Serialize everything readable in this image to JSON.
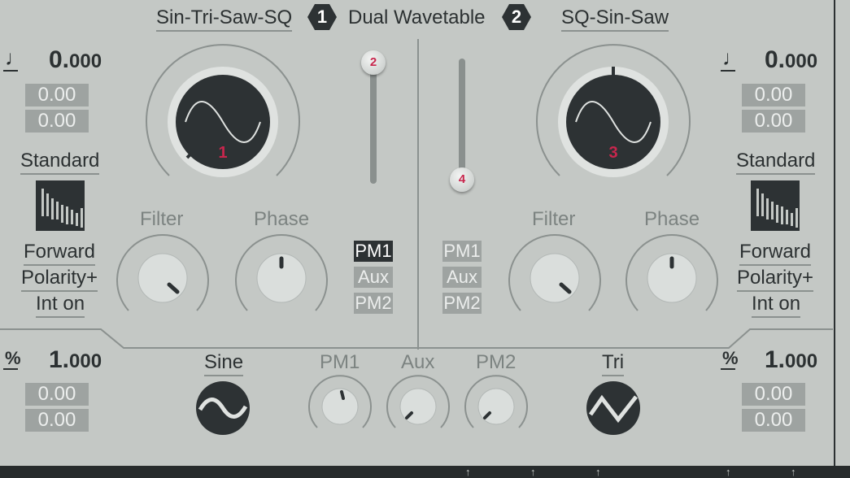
{
  "header": {
    "osc1_wavetable": "Sin-Tri-Saw-SQ",
    "osc1_badge": "1",
    "title": "Dual Wavetable",
    "osc2_badge": "2",
    "osc2_wavetable": "SQ-Sin-Saw"
  },
  "osc1": {
    "note_icon": "note-icon",
    "pitch_int": "0.",
    "pitch_frac": "000",
    "pitch_val1": "0.00",
    "pitch_val2": "0.00",
    "mode": "Standard",
    "direction": "Forward",
    "polarity": "Polarity+",
    "interp": "Int on",
    "main_knob_marker": "1",
    "filter_label": "Filter",
    "phase_label": "Phase",
    "percent_icon": "percent-icon",
    "amount_int": "1.",
    "amount_frac": "000",
    "amount_val1": "0.00",
    "amount_val2": "0.00"
  },
  "osc2": {
    "note_icon": "note-icon",
    "pitch_int": "0.",
    "pitch_frac": "000",
    "pitch_val1": "0.00",
    "pitch_val2": "0.00",
    "mode": "Standard",
    "direction": "Forward",
    "polarity": "Polarity+",
    "interp": "Int on",
    "main_knob_marker": "3",
    "filter_label": "Filter",
    "phase_label": "Phase",
    "percent_icon": "percent-icon",
    "amount_int": "1.",
    "amount_frac": "000",
    "amount_val1": "0.00",
    "amount_val2": "0.00"
  },
  "faders": {
    "fader1_marker": "2",
    "fader2_marker": "4"
  },
  "mod_buttons_left": [
    "PM1",
    "Aux",
    "PM2"
  ],
  "mod_buttons_right": [
    "PM1",
    "Aux",
    "PM2"
  ],
  "bottom": {
    "lfo1_shape": "Sine",
    "lfo2_shape": "Tri",
    "pm1_label": "PM1",
    "aux_label": "Aux",
    "pm2_label": "PM2"
  },
  "colors": {
    "background": "#c4c8c5",
    "dark": "#2d3234",
    "accent": "#c8264d",
    "value_box": "#9ea3a1"
  }
}
